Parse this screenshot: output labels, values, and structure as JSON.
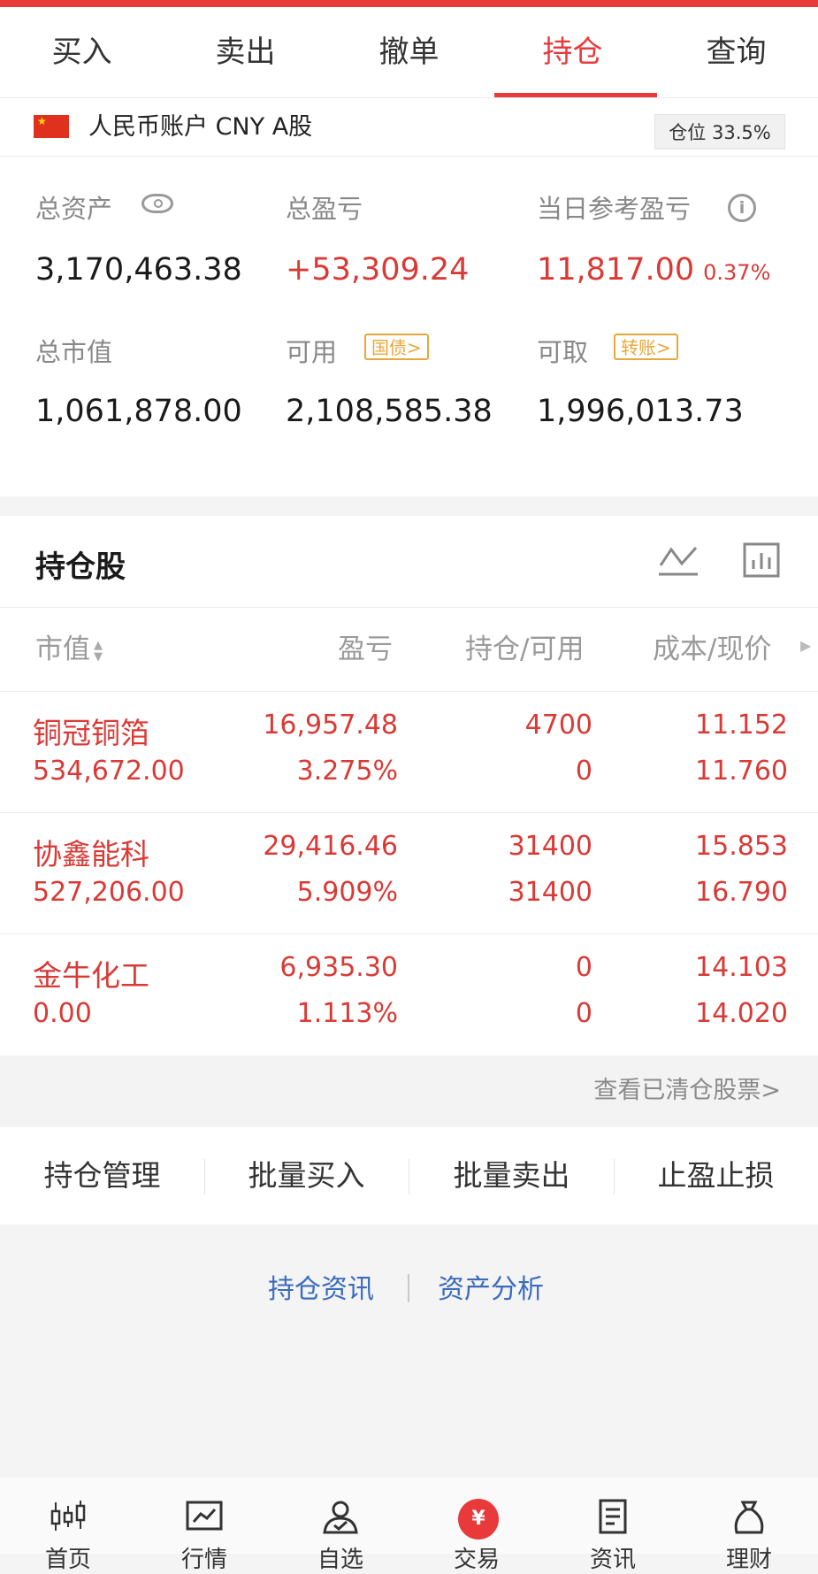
{
  "tabs": [
    {
      "label": "买入"
    },
    {
      "label": "卖出"
    },
    {
      "label": "撤单"
    },
    {
      "label": "持仓",
      "active": true
    },
    {
      "label": "查询"
    }
  ],
  "account": {
    "label": "人民币账户 CNY A股",
    "position_ratio": "仓位 33.5%"
  },
  "summary": {
    "total_assets_label": "总资产",
    "total_assets": "3,170,463.38",
    "total_pnl_label": "总盈亏",
    "total_pnl": "+53,309.24",
    "daily_pnl_label": "当日参考盈亏",
    "daily_pnl": "11,817.00",
    "daily_pnl_pct": "0.37%",
    "market_value_label": "总市值",
    "market_value": "1,061,878.00",
    "available_label": "可用",
    "available_tag": "国债>",
    "available": "2,108,585.38",
    "withdrawable_label": "可取",
    "withdrawable_tag": "转账>",
    "withdrawable": "1,996,013.73"
  },
  "holdings": {
    "title": "持仓股",
    "columns": [
      "市值",
      "盈亏",
      "持仓/可用",
      "成本/现价"
    ],
    "rows": [
      {
        "name": "铜冠铜箔",
        "market_value": "534,672.00",
        "pnl": "16,957.48",
        "pnl_pct": "3.275%",
        "position": "4700",
        "available": "0",
        "cost": "11.152",
        "price": "11.760"
      },
      {
        "name": "协鑫能科",
        "market_value": "527,206.00",
        "pnl": "29,416.46",
        "pnl_pct": "5.909%",
        "position": "31400",
        "available": "31400",
        "cost": "15.853",
        "price": "16.790"
      },
      {
        "name": "金牛化工",
        "market_value": "0.00",
        "pnl": "6,935.30",
        "pnl_pct": "1.113%",
        "position": "0",
        "available": "0",
        "cost": "14.103",
        "price": "14.020"
      }
    ]
  },
  "cleared_link": "查看已清仓股票>",
  "actions": [
    "持仓管理",
    "批量买入",
    "批量卖出",
    "止盈止损"
  ],
  "links": [
    "持仓资讯",
    "资产分析"
  ],
  "bottom_nav": [
    {
      "label": "首页",
      "icon": "candlestick-icon"
    },
    {
      "label": "行情",
      "icon": "chart-line-icon"
    },
    {
      "label": "自选",
      "icon": "user-check-icon"
    },
    {
      "label": "交易",
      "icon": "yuan-icon"
    },
    {
      "label": "资讯",
      "icon": "document-icon"
    },
    {
      "label": "理财",
      "icon": "money-bag-icon"
    }
  ],
  "colors": {
    "accent": "#e8393b",
    "profit": "#d93a36",
    "link": "#3a6bbd",
    "tag": "#e8a73a"
  }
}
